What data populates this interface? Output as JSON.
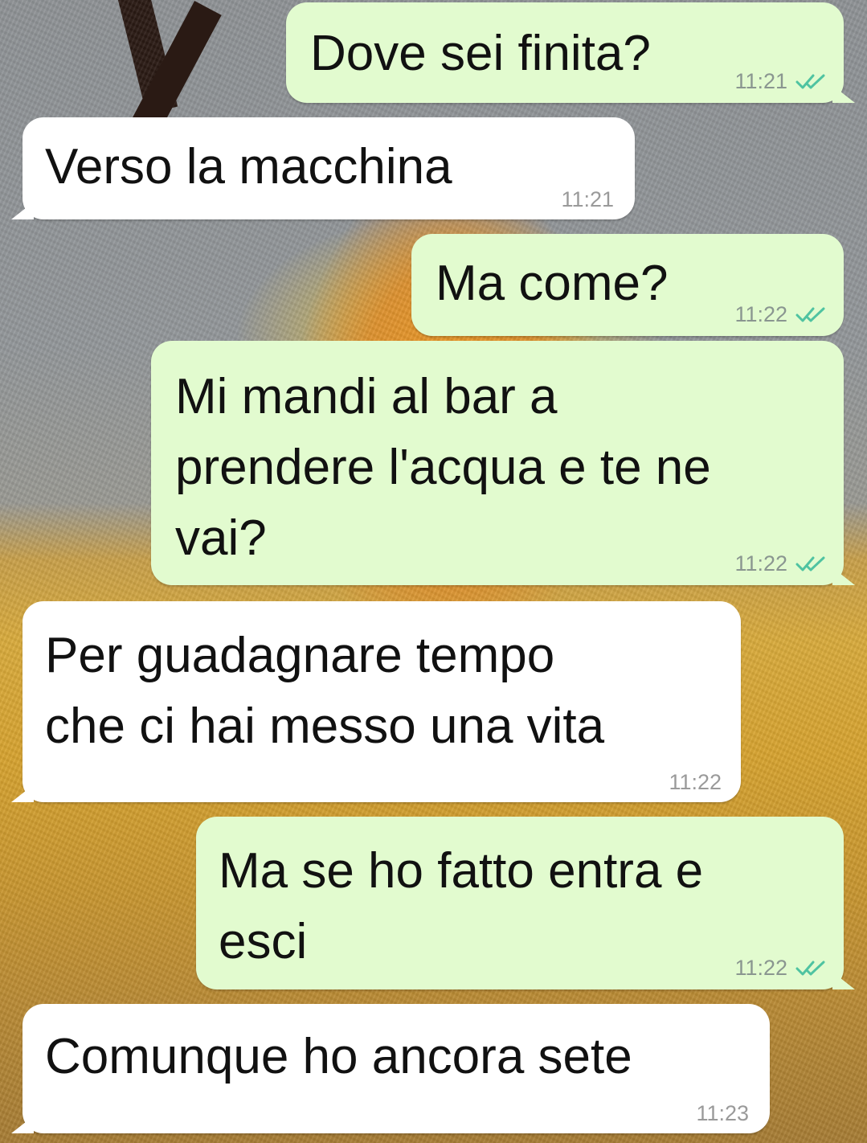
{
  "chat": {
    "messages": [
      {
        "direction": "outgoing",
        "text": "Dove sei finita?",
        "time": "11:21",
        "status": "read-double-check-icon"
      },
      {
        "direction": "incoming",
        "text": "Verso la macchina",
        "time": "11:21"
      },
      {
        "direction": "outgoing",
        "text": "Ma come?",
        "time": "11:22",
        "status": "read-double-check-icon"
      },
      {
        "direction": "outgoing",
        "text": "Mi mandi al bar a\nprendere l'acqua e te ne\nvai?",
        "time": "11:22",
        "status": "read-double-check-icon"
      },
      {
        "direction": "incoming",
        "text": "Per guadagnare tempo\nche ci hai messo una vita",
        "time": "11:22"
      },
      {
        "direction": "outgoing",
        "text": "Ma se ho fatto entra e\nesci",
        "time": "11:22",
        "status": "read-double-check-icon"
      },
      {
        "direction": "incoming",
        "text": "Comunque ho ancora sete",
        "time": "11:23"
      }
    ]
  },
  "colors": {
    "outgoing_bubble": "#e2fbcf",
    "incoming_bubble": "#ffffff",
    "read_ticks": "#4fc3a1",
    "timestamp": "#8a9690"
  }
}
